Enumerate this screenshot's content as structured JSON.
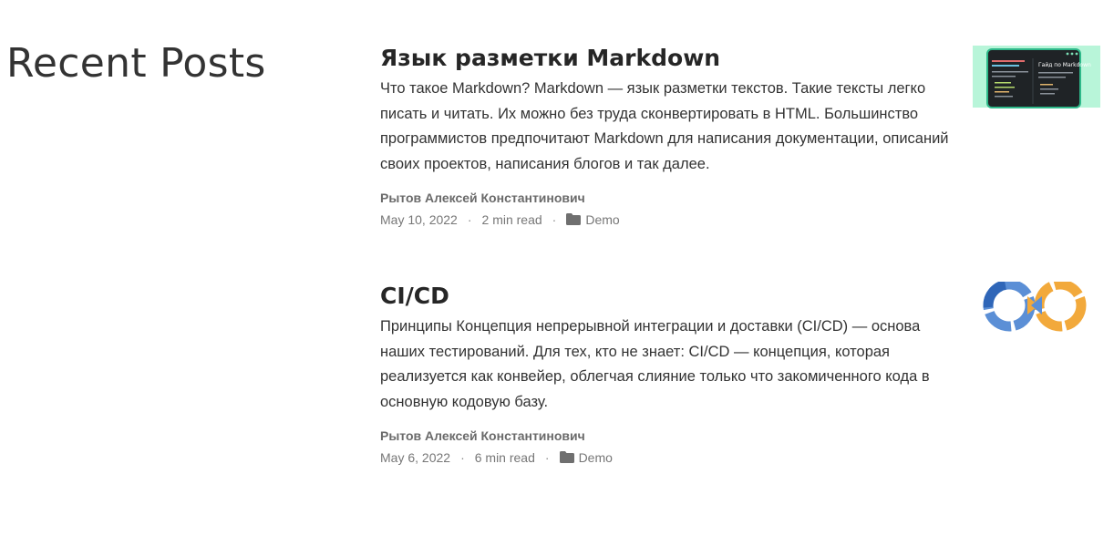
{
  "section": {
    "title": "Recent Posts"
  },
  "posts": [
    {
      "title": "Язык разметки Markdown",
      "excerpt": "Что такое Markdown? Markdown — язык разметки текстов. Такие тексты легко писать и читать. Их можно без труда сконвертировать в HTML. Большинство программистов предпочитают Markdown для написания документации, описаний своих проектов, написания блогов и так далее.",
      "author": "Рытов Алексей Константинович",
      "date": "May 10, 2022",
      "read_time": "2 min read",
      "category": "Demo",
      "thumbnail": {
        "icon": "markdown-guide-thumbnail",
        "caption": "Гайд по Markdown",
        "bg": "#b8f5d9",
        "frame": "#2fb98a",
        "screen": "#1f2326"
      }
    },
    {
      "title": "CI/CD",
      "excerpt": "Принципы Концепция непрерывной интеграции и доставки (CI/CD) — основа наших тестирований. Для тех, кто не знает: CI/CD — концепция, которая реализуется как конвейер, облегчая слияние только что закомиченного кода в основную кодовую базу.",
      "author": "Рытов Алексей Константинович",
      "date": "May 6, 2022",
      "read_time": "6 min read",
      "category": "Demo",
      "thumbnail": {
        "icon": "cicd-infinity-loop-thumbnail",
        "dev_color": "#5b8fd6",
        "ops_color": "#f2a93b"
      }
    }
  ],
  "meta": {
    "separator": "·"
  }
}
